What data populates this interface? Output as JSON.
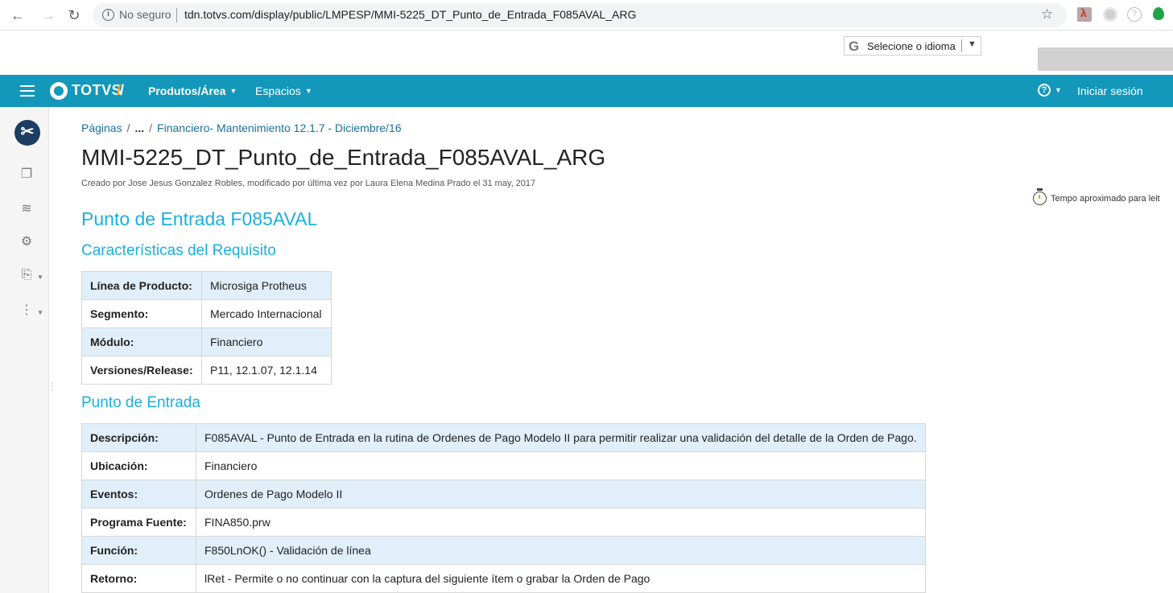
{
  "browser": {
    "security_label": "No seguro",
    "url": "tdn.totvs.com/display/public/LMPESP/MMI-5225_DT_Punto_de_Entrada_F085AVAL_ARG"
  },
  "translate": {
    "label": "Selecione o idioma",
    "caret": "▼"
  },
  "header": {
    "logo_text": "TOTVS",
    "menu_produtos": "Produtos/Área",
    "menu_espacos": "Espacios",
    "login": "Iniciar sesión"
  },
  "breadcrumb": {
    "root": "Páginas",
    "ellipsis": "...",
    "parent": "Financiero- Mantenimiento 12.1.7 - Diciembre/16"
  },
  "page": {
    "title": "MMI-5225_DT_Punto_de_Entrada_F085AVAL_ARG",
    "byline": "Creado por Jose Jesus Gonzalez Robles, modificado por última vez por Laura Elena Medina Prado el 31 may, 2017",
    "read_time": "Tempo aproximado para leit"
  },
  "content": {
    "heading_main": "Punto de Entrada F085AVAL",
    "heading_requisito": "Características del Requisito",
    "heading_punto": "Punto de Entrada",
    "requisito_rows": [
      {
        "label": "Línea de Producto:",
        "value": "Microsiga Protheus"
      },
      {
        "label": "Segmento:",
        "value": "Mercado Internacional"
      },
      {
        "label": "Módulo:",
        "value": "Financiero"
      },
      {
        "label": "Versiones/Release:",
        "value": "P11, 12.1.07, 12.1.14"
      }
    ],
    "punto_rows": [
      {
        "label": "Descripción:",
        "value": "F085AVAL - Punto de Entrada en la rutina de Ordenes de Pago Modelo II para permitir realizar una validación del detalle de la Orden de Pago."
      },
      {
        "label": "Ubicación:",
        "value": "Financiero"
      },
      {
        "label": "Eventos:",
        "value": "Ordenes de Pago Modelo II"
      },
      {
        "label": "Programa Fuente:",
        "value": "FINA850.prw"
      },
      {
        "label": "Función:",
        "value": "F850LnOK() - Validación de línea"
      },
      {
        "label": "Retorno:",
        "value": "lRet - Permite o no continuar con la captura del siguiente ítem o grabar la Orden de Pago"
      }
    ]
  },
  "colors": {
    "header_bg": "#1397ba",
    "heading_blue": "#19b0e0",
    "link_blue": "#1a6f9d",
    "row_alt": "#e1effa",
    "logo_accent": "#f0a500"
  }
}
